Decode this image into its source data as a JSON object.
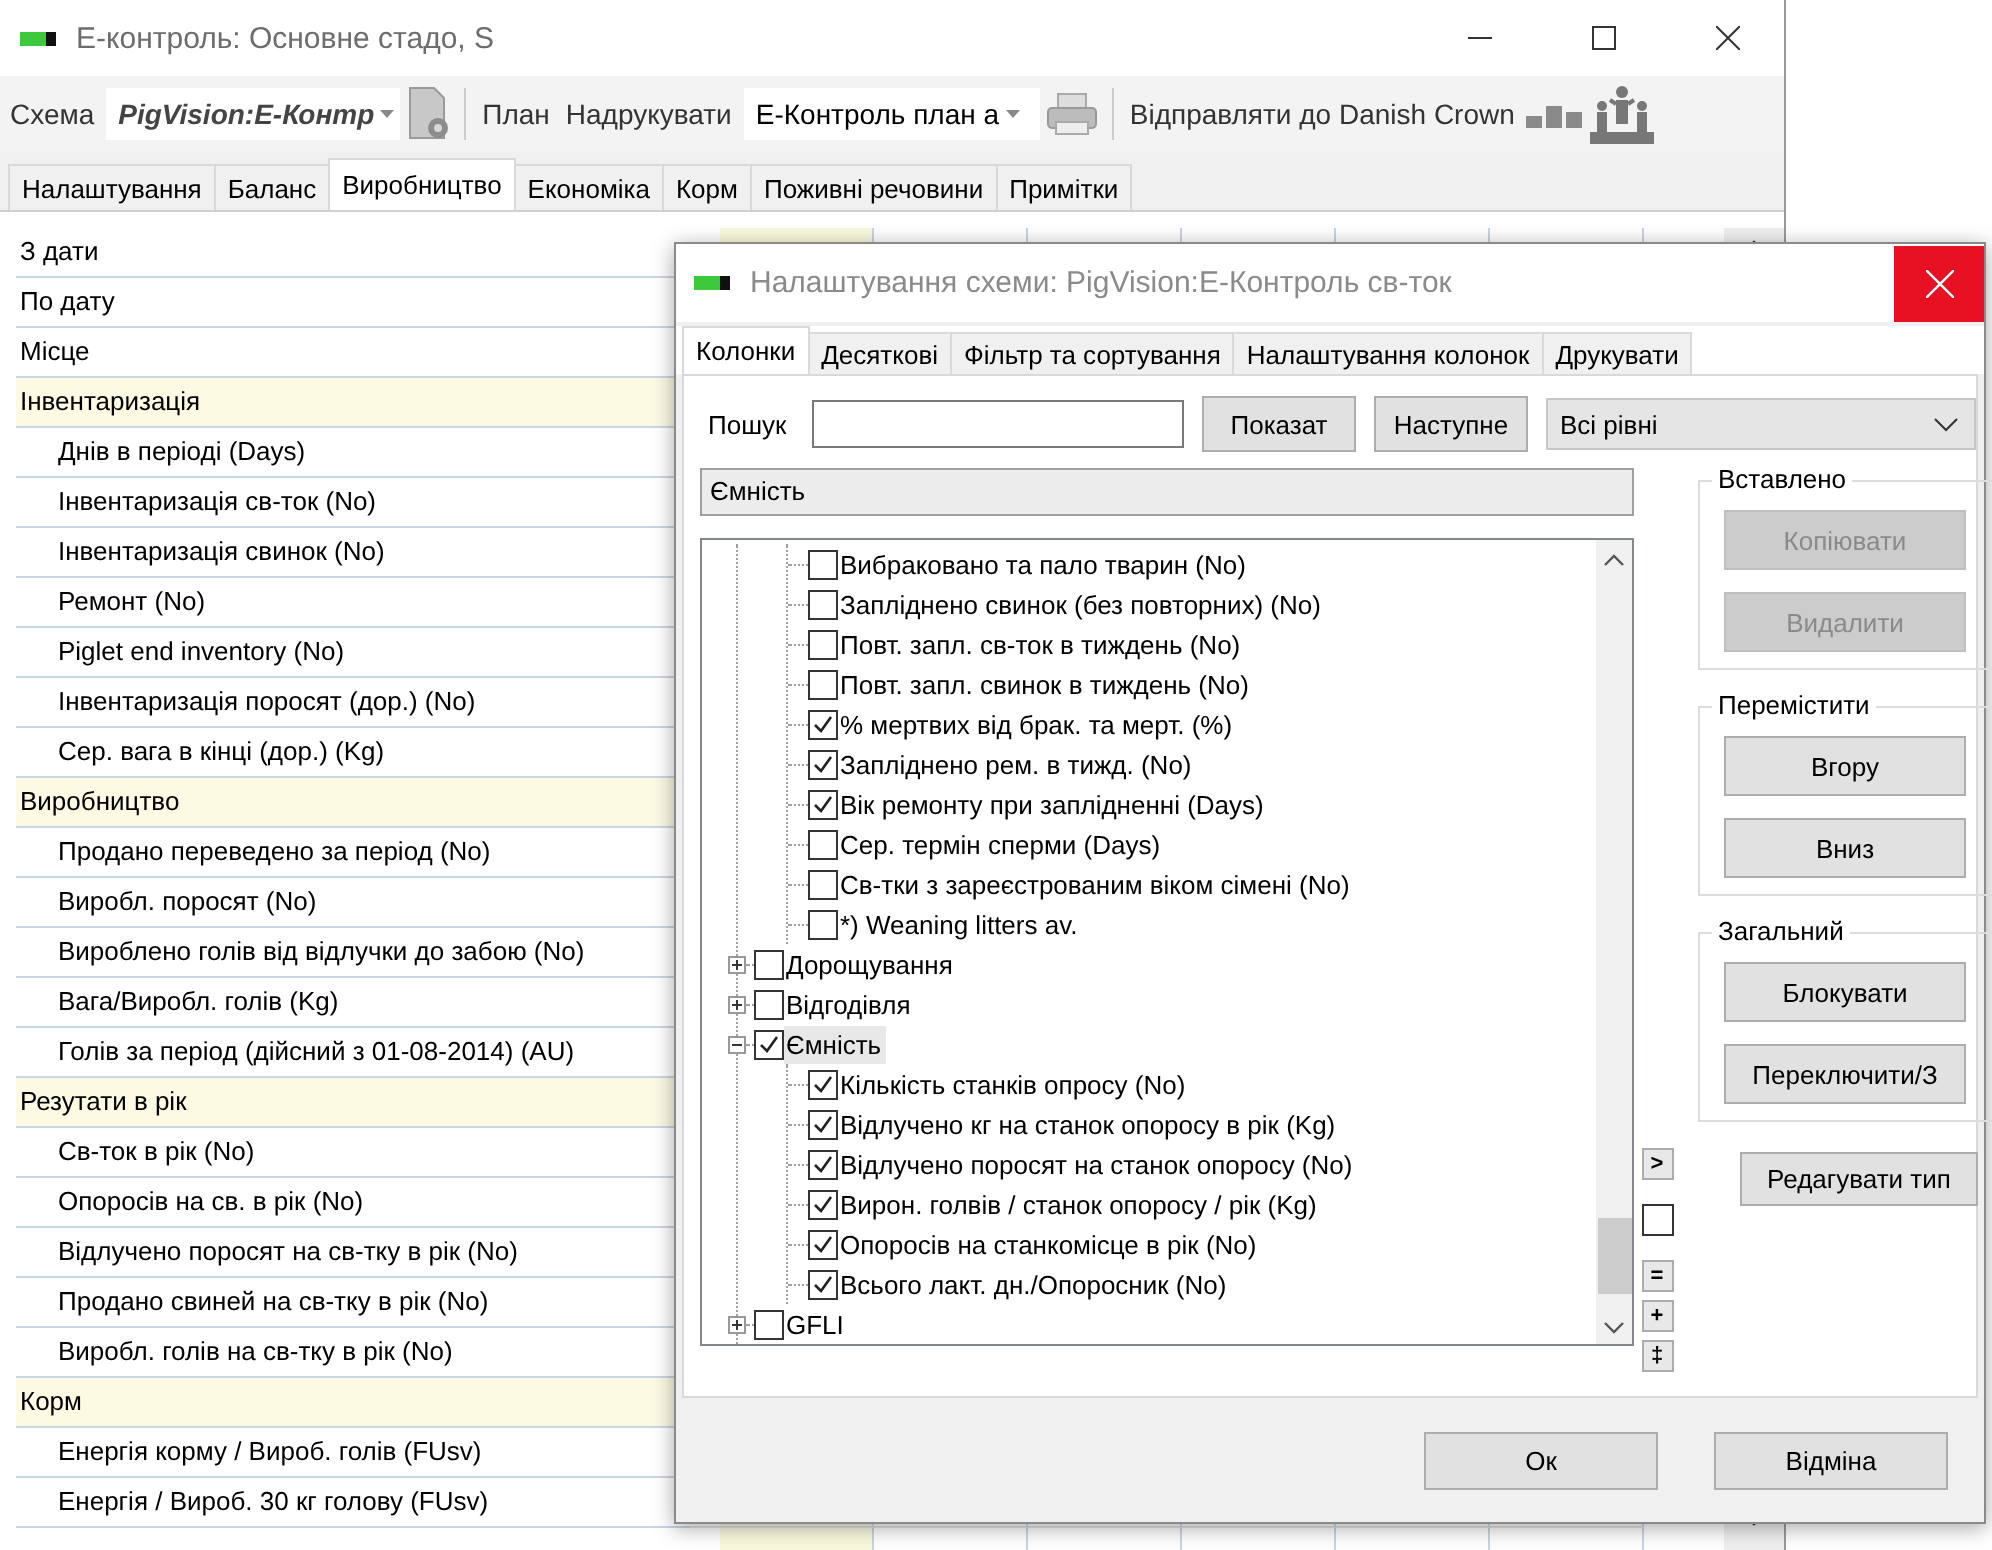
{
  "window": {
    "title": "E-контроль: Основне стадо, S"
  },
  "toolbar": {
    "scheme_label": "Схема",
    "scheme_value": "PigVision:E-Контр",
    "plan_button": "План",
    "print_button": "Надрукувати",
    "plan_value": "E-Контроль план а",
    "send_button": "Відправляти до Danish Crown"
  },
  "tabs": [
    {
      "label": "Налаштування",
      "selected": false
    },
    {
      "label": "Баланс",
      "selected": false
    },
    {
      "label": "Виробництво",
      "selected": true
    },
    {
      "label": "Економіка",
      "selected": false
    },
    {
      "label": "Корм",
      "selected": false
    },
    {
      "label": "Поживні речовини",
      "selected": false
    },
    {
      "label": "Примітки",
      "selected": false
    }
  ],
  "rows": [
    {
      "kind": "field",
      "label": "З дати"
    },
    {
      "kind": "field",
      "label": "По дату"
    },
    {
      "kind": "field",
      "label": "Місце"
    },
    {
      "kind": "section",
      "label": "Інвентаризація"
    },
    {
      "kind": "item",
      "label": "Днів в періоді (Days)"
    },
    {
      "kind": "item",
      "label": "Інвентаризація св-ток (No)"
    },
    {
      "kind": "item",
      "label": "Інвентаризація свинок (No)"
    },
    {
      "kind": "item",
      "label": "Ремонт (No)"
    },
    {
      "kind": "item",
      "label": "Piglet end inventory (No)"
    },
    {
      "kind": "item",
      "label": "Інвентаризація поросят (дор.) (No)"
    },
    {
      "kind": "item",
      "label": "Сер. вага в кінці (дор.) (Kg)"
    },
    {
      "kind": "section",
      "label": "Виробництво"
    },
    {
      "kind": "item",
      "label": "Продано переведено за період (No)"
    },
    {
      "kind": "item",
      "label": "Виробл. поросят (No)"
    },
    {
      "kind": "item",
      "label": "Вироблено голів від відлучки до забою (No)"
    },
    {
      "kind": "item",
      "label": "Вага/Виробл. голів (Kg)"
    },
    {
      "kind": "item",
      "label": "Голів за період (дійсний з 01-08-2014) (AU)"
    },
    {
      "kind": "section",
      "label": "Резутати в рік"
    },
    {
      "kind": "item",
      "label": "Св-ток в рік (No)"
    },
    {
      "kind": "item",
      "label": "Опоросів на св. в рік (No)"
    },
    {
      "kind": "item",
      "label": "Відлучено поросят на св-тку в рік (No)"
    },
    {
      "kind": "item",
      "label": "Продано свиней на св-тку в рік (No)"
    },
    {
      "kind": "item",
      "label": "Виробл. голів на св-тку в рік (No)"
    },
    {
      "kind": "section",
      "label": "Корм"
    },
    {
      "kind": "item",
      "label": "Енергія корму / Вироб. голів (FUsv)"
    },
    {
      "kind": "item",
      "label": "Енергія / Вироб. 30 кг голову (FUsv)"
    }
  ],
  "dialog": {
    "title": "Налаштування схеми: PigVision:E-Контроль св-ток",
    "tabs": [
      {
        "label": "Колонки",
        "selected": true
      },
      {
        "label": "Десяткові",
        "selected": false
      },
      {
        "label": "Фільтр та сортування",
        "selected": false
      },
      {
        "label": "Налаштування колонок",
        "selected": false
      },
      {
        "label": "Друкувати",
        "selected": false
      }
    ],
    "search_label": "Пошук",
    "show_button": "Показат",
    "next_button": "Наступне",
    "level_select": "Всі рівні",
    "current": "Ємність",
    "tree": {
      "orphan_children": [
        {
          "label": "Вибраковано та пало тварин (No)",
          "checked": false,
          "selected": false
        },
        {
          "label": "Запліднено свинок  (без повторних) (No)",
          "checked": false,
          "selected": false
        },
        {
          "label": "Повт. запл. св-ток в тиждень (No)",
          "checked": false,
          "selected": false
        },
        {
          "label": "Повт. запл. свинок в тиждень (No)",
          "checked": false,
          "selected": false
        },
        {
          "label": "% мертвих від брак. та мерт. (%)",
          "checked": true,
          "selected": false
        },
        {
          "label": "Запліднено рем. в тижд. (No)",
          "checked": true,
          "selected": false
        },
        {
          "label": "Вік ремонту при заплідненні (Days)",
          "checked": true,
          "selected": false
        },
        {
          "label": "Сер. термін сперми (Days)",
          "checked": false,
          "selected": false
        },
        {
          "label": "Св-тки з зареєстрованим віком сімені (No)",
          "checked": false,
          "selected": false
        },
        {
          "label": "*) Weaning litters av.",
          "checked": false,
          "selected": false
        }
      ],
      "nodes": [
        {
          "label": "Дорощування",
          "checked": false,
          "expanded": false,
          "selected": false
        },
        {
          "label": "Відгодівля",
          "checked": false,
          "expanded": false,
          "selected": false
        },
        {
          "label": "Ємність",
          "checked": true,
          "expanded": true,
          "selected": true,
          "children": [
            {
              "label": "Кількість станків опросу (No)",
              "checked": true,
              "selected": false
            },
            {
              "label": "Відлучено кг на станок опоросу в рік (Kg)",
              "checked": true,
              "selected": false
            },
            {
              "label": "Відлучено поросят на станок опоросу (No)",
              "checked": true,
              "selected": false
            },
            {
              "label": "Вирон. голвів / станок опоросу / рік (Kg)",
              "checked": true,
              "selected": false
            },
            {
              "label": "Опоросів на станкомісце в рік (No)",
              "checked": true,
              "selected": false
            },
            {
              "label": "Всього лакт. дн./Опоросник (No)",
              "checked": true,
              "selected": false
            }
          ]
        },
        {
          "label": "GFLI",
          "checked": false,
          "expanded": false,
          "selected": false
        }
      ]
    },
    "groups": [
      {
        "title": "Вставлено",
        "buttons": [
          {
            "label": "Копіювати",
            "disabled": true
          },
          {
            "label": "Видалити",
            "disabled": true
          }
        ]
      },
      {
        "title": "Перемістити",
        "buttons": [
          {
            "label": "Вгору",
            "disabled": false
          },
          {
            "label": "Вниз",
            "disabled": false
          }
        ]
      },
      {
        "title": "Загальний",
        "buttons": [
          {
            "label": "Блокувати",
            "disabled": false
          },
          {
            "label": "Переключити/З",
            "disabled": false
          }
        ]
      }
    ],
    "edit_type_button": "Редагувати тип",
    "side_controls": [
      {
        "kind": "button",
        "text": ">"
      },
      {
        "kind": "checkbox",
        "checked": false
      },
      {
        "kind": "button",
        "text": "="
      },
      {
        "kind": "button",
        "text": "+"
      },
      {
        "kind": "button",
        "text": "‡"
      }
    ],
    "ok_button": "Ок",
    "cancel_button": "Відміна"
  }
}
